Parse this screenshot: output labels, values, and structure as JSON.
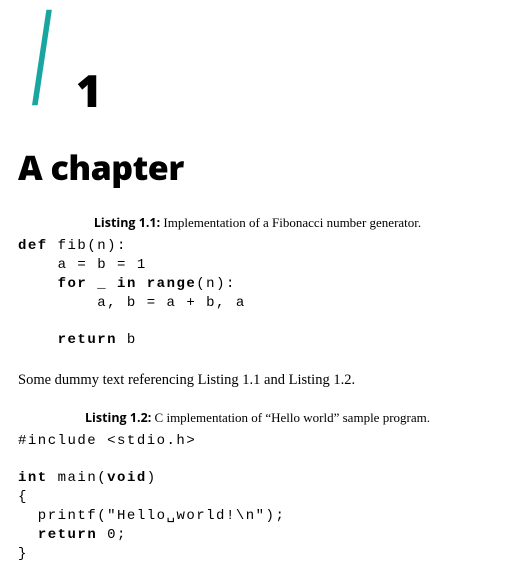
{
  "chapter": {
    "number": "1",
    "title": "A chapter"
  },
  "listing1": {
    "label": "Listing 1.1:",
    "caption": "Implementation of a Fibonacci number generator.",
    "kw_def": "def",
    "fn": " fib(n):",
    "line2": "    a = b = 1",
    "kw_for": "for",
    "line3a": "    ",
    "line3b": " _ ",
    "kw_in": "in",
    "kw_range": " range",
    "line3c": "(n):",
    "line4": "        a, b = a + b, a",
    "kw_return": "return",
    "line6a": "    ",
    "line6b": " b"
  },
  "body": {
    "text": "Some dummy text referencing Listing 1.1 and Listing 1.2."
  },
  "listing2": {
    "label": "Listing 1.2:",
    "caption": "C implementation of “Hello world” sample program.",
    "line1": "#include <stdio.h>",
    "kw_int": "int",
    "line3a": " main(",
    "kw_void": "void",
    "line3b": ")",
    "line4": "{",
    "line5": "  printf(\"Hello␣world!\\n\");",
    "kw_return": "return",
    "line6a": "  ",
    "line6b": " 0;",
    "line7": "}"
  }
}
